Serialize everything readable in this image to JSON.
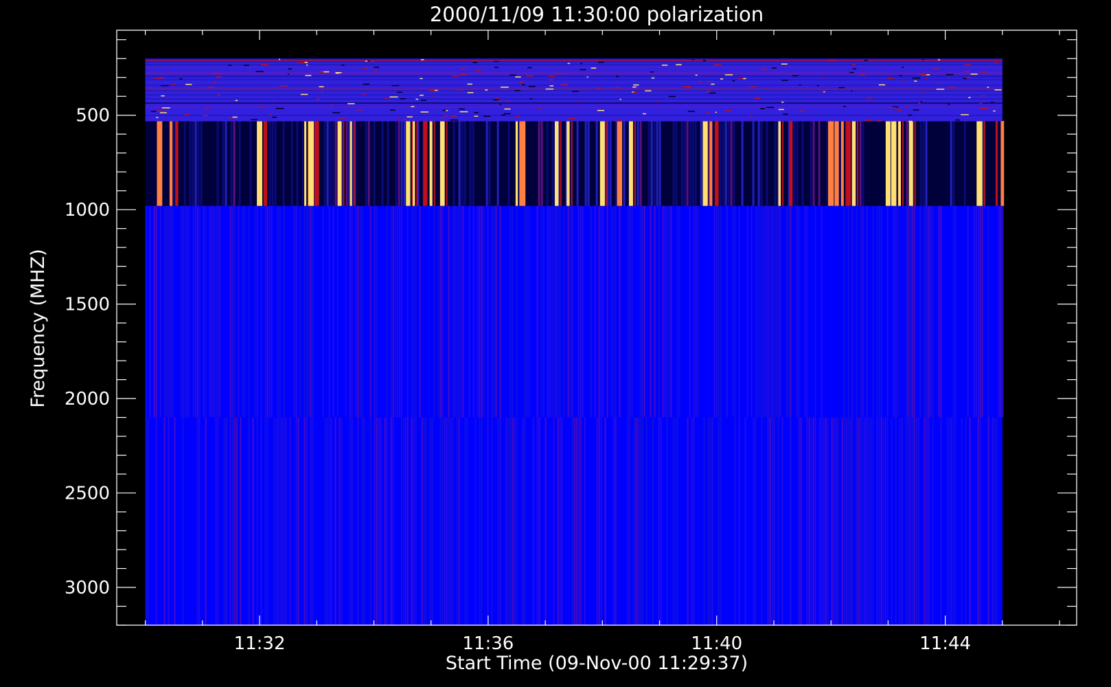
{
  "chart_data": {
    "type": "heatmap",
    "title": "2000/11/09 11:30:00 polarization",
    "xlabel": "Start Time (09-Nov-00 11:29:37)",
    "ylabel": "Frequency (MHZ)",
    "x_tick_labels": [
      "11:32",
      "11:36",
      "11:40",
      "11:44"
    ],
    "x_tick_values_min": [
      2.0,
      6.0,
      10.0,
      14.0
    ],
    "x_range_min": [
      -0.5,
      16.3
    ],
    "data_x_range_min": [
      0.0,
      15.0
    ],
    "y_tick_labels": [
      "500",
      "1000",
      "1500",
      "2000",
      "2500",
      "3000"
    ],
    "y_tick_values": [
      500,
      1000,
      1500,
      2000,
      2500,
      3000
    ],
    "y_range": [
      50,
      3200
    ],
    "y_inverted": true,
    "grid": false,
    "bands": [
      {
        "from_mhz": 200,
        "to_mhz": 530,
        "character": "noisy blue with red/yellow streaks"
      },
      {
        "from_mhz": 530,
        "to_mhz": 980,
        "character": "intermittent broadband bursts (bright vertical stripes)"
      },
      {
        "from_mhz": 980,
        "to_mhz": 2100,
        "character": "uniform blue"
      },
      {
        "from_mhz": 2100,
        "to_mhz": 3200,
        "character": "uniform blue"
      }
    ],
    "burst_times_min": [
      0.25,
      0.45,
      0.55,
      2.0,
      2.1,
      2.8,
      2.9,
      3.0,
      3.4,
      3.6,
      4.6,
      4.7,
      4.9,
      5.0,
      5.2,
      6.5,
      6.6,
      7.2,
      7.4,
      8.0,
      8.3,
      8.5,
      9.8,
      9.9,
      10.0,
      11.1,
      11.3,
      12.0,
      12.1,
      12.2,
      12.3,
      12.4,
      13.0,
      13.1,
      13.2,
      13.4,
      14.6,
      14.9,
      15.0
    ],
    "colors": {
      "background": "#000000",
      "axis": "#ffffff",
      "low": "#0000ff",
      "dark": "#00003a",
      "mid": "#c0101a",
      "high": "#ffe070",
      "peak": "#ffffff"
    }
  }
}
